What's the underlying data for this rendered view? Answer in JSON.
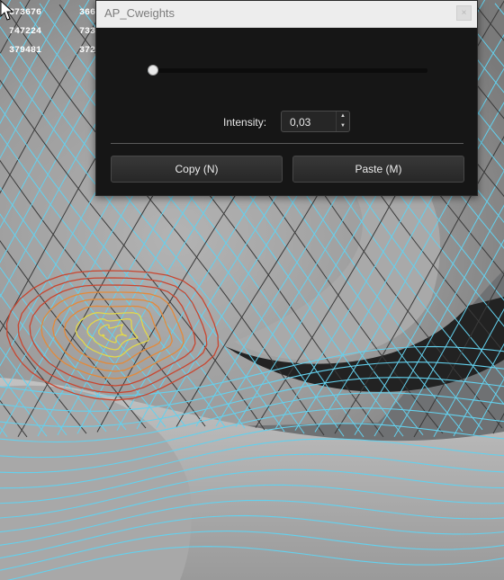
{
  "window": {
    "title": "AP_Cweights",
    "close_glyph": "×"
  },
  "slider": {
    "value_fraction": 0.02,
    "track_color": "#0c0c0c",
    "fill_color": "#3c6f8f"
  },
  "intensity": {
    "label": "Intensity:",
    "value": "0,03"
  },
  "buttons": {
    "copy_label": "Copy (N)",
    "paste_label": "Paste (M)"
  },
  "hud": {
    "rows": [
      {
        "left": "373676",
        "right": "366"
      },
      {
        "left": "747224",
        "right": "733"
      },
      {
        "left": "379481",
        "right": "372"
      }
    ]
  },
  "viewport": {
    "wire_color": "#63d1ee",
    "mesh_color": "#a5a5a5",
    "weight_colors": [
      "#e2d84a",
      "#e38a3a",
      "#c84630"
    ]
  },
  "icons": {
    "close": "close-icon",
    "spin_up": "chevron-up-icon",
    "spin_down": "chevron-down-icon",
    "cursor": "mouse-pointer-icon"
  }
}
